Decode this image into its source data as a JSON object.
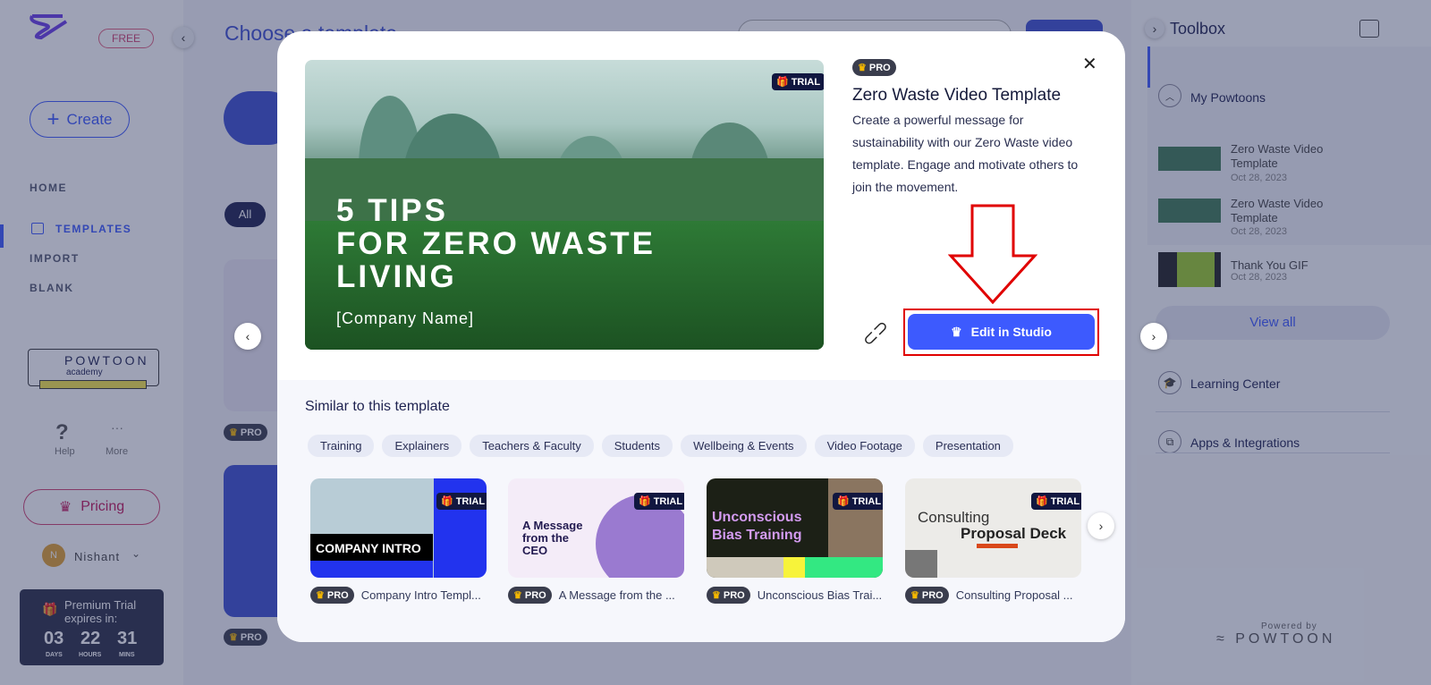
{
  "sidebar": {
    "free_badge": "FREE",
    "create": "Create",
    "nav": [
      "HOME",
      "TEMPLATES",
      "IMPORT",
      "BLANK"
    ],
    "academy_title": "POWTOON",
    "academy_sub": "academy",
    "help": "Help",
    "more": "More",
    "pricing": "Pricing",
    "user_initial": "N",
    "user": "Nishant",
    "trial": {
      "title": "Premium Trial",
      "subtitle": "expires in:",
      "days": "03",
      "hours": "22",
      "mins": "31",
      "days_label": "DAYS",
      "hours_label": "HOURS",
      "mins_label": "MINS"
    }
  },
  "main": {
    "title": "Choose a template",
    "filter_all": "All",
    "pro": "PRO"
  },
  "toolbox": {
    "title": "Toolbox",
    "my_powtoons": "My Powtoons",
    "items": [
      {
        "title": "Zero Waste Video Template",
        "date": "Oct 28, 2023"
      },
      {
        "title": "Zero Waste Video Template",
        "date": "Oct 28, 2023"
      },
      {
        "title": "Thank You GIF",
        "date": "Oct 28, 2023"
      }
    ],
    "view_all": "View all",
    "learning": "Learning Center",
    "apps": "Apps & Integrations",
    "powered_by": "Powered by",
    "powered_brand": "POWTOON"
  },
  "modal": {
    "pro": "PRO",
    "trial": "TRIAL",
    "hero_line1": "5 TIPS",
    "hero_line2": "FOR ZERO WASTE",
    "hero_line3": "LIVING",
    "hero_company": "[Company Name]",
    "title": "Zero Waste Video Template",
    "description": "Create a powerful message for sustainability with our Zero Waste video template. Engage and motivate others to join the movement.",
    "edit_button": "Edit in Studio",
    "similar_heading": "Similar to this template",
    "chips": [
      "Training",
      "Explainers",
      "Teachers & Faculty",
      "Students",
      "Wellbeing & Events",
      "Video Footage",
      "Presentation"
    ],
    "cards": [
      {
        "thumb": "COMPANY INTRO",
        "label": "Company Intro Templ..."
      },
      {
        "thumb": "A Message from the CEO",
        "label": "A Message from the ..."
      },
      {
        "thumb": "Unconscious Bias Training",
        "label": "Unconscious Bias Trai..."
      },
      {
        "thumb_a": "Consulting",
        "thumb": "Proposal Deck",
        "label": "Consulting Proposal ..."
      }
    ]
  },
  "colors": {
    "accent": "#3d5afe",
    "pricing": "#c2185b",
    "highlight": "#e00000"
  }
}
